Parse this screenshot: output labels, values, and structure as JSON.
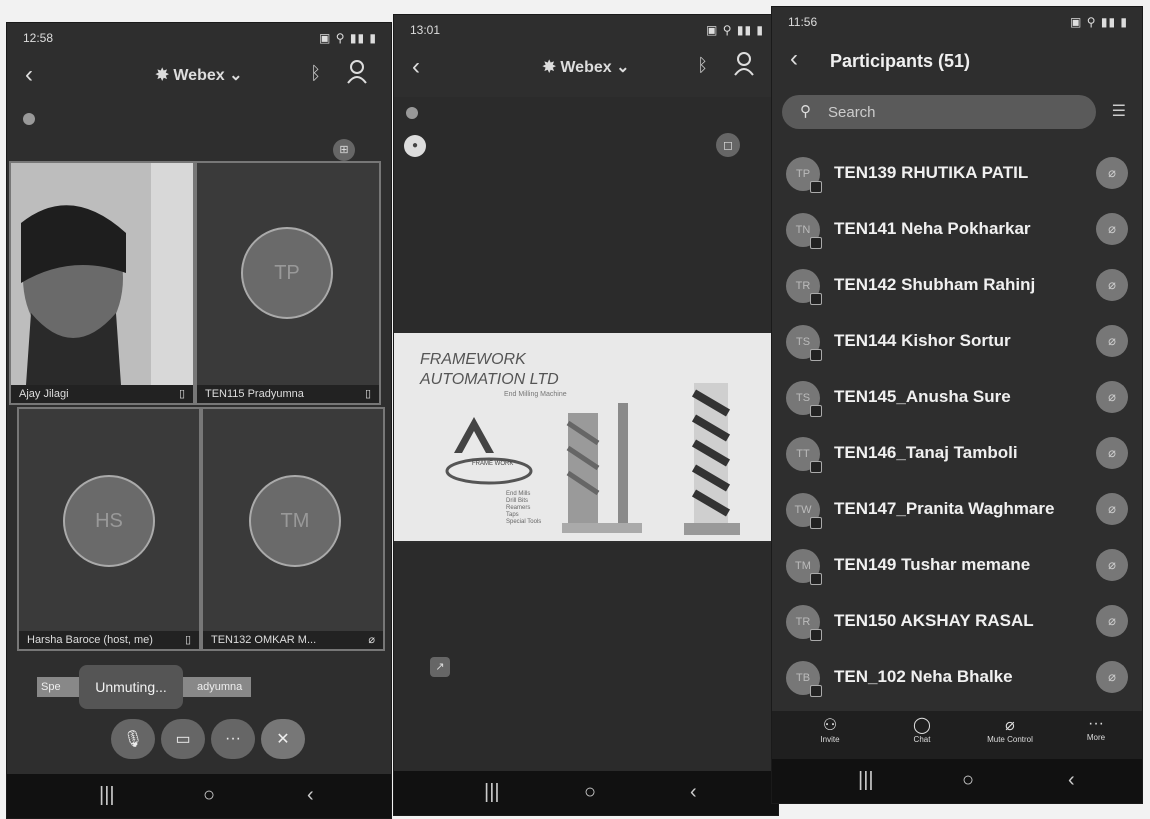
{
  "screen1": {
    "status_time": "12:58",
    "brand": "Webex",
    "tiles": [
      {
        "name": "Ajay Jilagi",
        "initials": ""
      },
      {
        "name": "TEN115 Pradyumna",
        "initials": "TP"
      },
      {
        "name": "Harsha Baroce (host, me)",
        "initials": "HS"
      },
      {
        "name": "TEN132 OMKAR M...",
        "initials": "TM"
      }
    ],
    "toast": "Unmuting...",
    "speaker_prefix": "Spe",
    "speaker_suffix": "adyumna"
  },
  "screen2": {
    "status_time": "13:01",
    "brand": "Webex",
    "banner_title1": "FRAMEWORK",
    "banner_title2": "AUTOMATION LTD",
    "banner_sub": "End Milling Machine",
    "banner_logo_text": "FRAME WORK",
    "banner_products": [
      "End Mills",
      "Drill Bits",
      "Reamers",
      "Taps",
      "Special Tools"
    ]
  },
  "screen3": {
    "status_time": "11:56",
    "title": "Participants (51)",
    "search_placeholder": "Search",
    "participants": [
      {
        "initials": "TP",
        "name": "TEN139 RHUTIKA PATIL"
      },
      {
        "initials": "TN",
        "name": "TEN141 Neha Pokharkar"
      },
      {
        "initials": "TR",
        "name": "TEN142 Shubham Rahinj"
      },
      {
        "initials": "TS",
        "name": "TEN144 Kishor Sortur"
      },
      {
        "initials": "TS",
        "name": "TEN145_Anusha Sure"
      },
      {
        "initials": "TT",
        "name": "TEN146_Tanaj Tamboli"
      },
      {
        "initials": "TW",
        "name": "TEN147_Pranita Waghmare"
      },
      {
        "initials": "TM",
        "name": "TEN149 Tushar memane"
      },
      {
        "initials": "TR",
        "name": "TEN150 AKSHAY RASAL"
      },
      {
        "initials": "TB",
        "name": "TEN_102 Neha Bhalke"
      }
    ],
    "tabs": {
      "invite": "Invite",
      "chat": "Chat",
      "mute": "Mute Control",
      "more": "More"
    }
  }
}
